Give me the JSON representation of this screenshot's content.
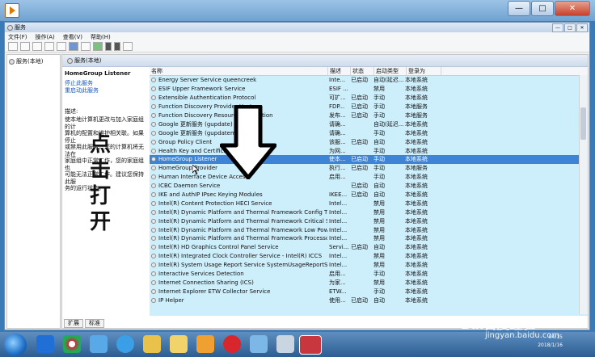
{
  "window": {
    "title": "服务",
    "close_glyph": "✕",
    "max_glyph": "□",
    "min_glyph": "—"
  },
  "menu": [
    "文件(F)",
    "操作(A)",
    "查看(V)",
    "帮助(H)"
  ],
  "tree": {
    "item": "服务(本地)"
  },
  "main_header": "服务(本地)",
  "description_panel": {
    "service_name": "HomeGroup Listener",
    "stop_link": "停止此服务",
    "restart_link": "重启动此服务",
    "desc_label": "描述:",
    "desc_text": "使本地计算机更改与加入家庭组的计\n算机的配置和维护相关联。如果停止\n或禁用此服务，您的计算机将无法在\n家庭组中正常工作，您的家庭组也\n可能无法正常工作。建议您保持此服\n务的运行状态。"
  },
  "columns": [
    "名称",
    "描述",
    "状态",
    "启动类型",
    "登录为"
  ],
  "rows": [
    [
      "Energy Server Service queencreek",
      "Inte...",
      "已启动",
      "自动(延迟...",
      "本地系统"
    ],
    [
      "ESIF Upper Framework Service",
      "ESIF ...",
      "",
      "禁用",
      "本地系统"
    ],
    [
      "Extensible Authentication Protocol",
      "可扩...",
      "已启动",
      "手动",
      "本地系统"
    ],
    [
      "Function Discovery Provider Host",
      "FDP...",
      "已启动",
      "手动",
      "本地服务"
    ],
    [
      "Function Discovery Resource Publication",
      "发布...",
      "已启动",
      "手动",
      "本地服务"
    ],
    [
      "Google 更新服务 (gupdate)",
      "请确...",
      "",
      "自动(延迟...",
      "本地系统"
    ],
    [
      "Google 更新服务 (gupdatem)",
      "请确...",
      "",
      "手动",
      "本地系统"
    ],
    [
      "Group Policy Client",
      "该服...",
      "已启动",
      "自动",
      "本地系统"
    ],
    [
      "Health Key and Certificate Management",
      "为网...",
      "",
      "手动",
      "本地系统"
    ],
    [
      "HomeGroup Listener",
      "使本...",
      "已启动",
      "手动",
      "本地系统"
    ],
    [
      "HomeGroup Provider",
      "执行...",
      "已启动",
      "手动",
      "本地服务"
    ],
    [
      "Human Interface Device Access",
      "启用...",
      "",
      "手动",
      "本地系统"
    ],
    [
      "ICBC Daemon Service",
      "",
      "已启动",
      "自动",
      "本地系统"
    ],
    [
      "IKE and AuthIP IPsec Keying Modules",
      "IKEE...",
      "已启动",
      "自动",
      "本地系统"
    ],
    [
      "Intel(R) Content Protection HECI Service",
      "Intel...",
      "",
      "禁用",
      "本地系统"
    ],
    [
      "Intel(R) Dynamic Platform and Thermal Framework Config TDP Se...",
      "Intel...",
      "",
      "禁用",
      "本地系统"
    ],
    [
      "Intel(R) Dynamic Platform and Thermal Framework Critical Service",
      "Intel...",
      "",
      "禁用",
      "本地系统"
    ],
    [
      "Intel(R) Dynamic Platform and Thermal Framework Low Power M...",
      "Intel...",
      "",
      "禁用",
      "本地系统"
    ],
    [
      "Intel(R) Dynamic Platform and Thermal Framework Processor Part...",
      "Intel...",
      "",
      "禁用",
      "本地系统"
    ],
    [
      "Intel(R) HD Graphics Control Panel Service",
      "Servi...",
      "已启动",
      "自动",
      "本地系统"
    ],
    [
      "Intel(R) Integrated Clock Controller Service - Intel(R) ICCS",
      "Intel...",
      "",
      "禁用",
      "本地系统"
    ],
    [
      "Intel(R) System Usage Report Service SystemUsageReportSvc QU...",
      "Intel...",
      "",
      "禁用",
      "本地系统"
    ],
    [
      "Interactive Services Detection",
      "启用...",
      "",
      "手动",
      "本地系统"
    ],
    [
      "Internet Connection Sharing (ICS)",
      "为家...",
      "",
      "禁用",
      "本地系统"
    ],
    [
      "Internet Explorer ETW Collector Service",
      "ETW...",
      "",
      "手动",
      "本地系统"
    ],
    [
      "IP Helper",
      "使用...",
      "已启动",
      "自动",
      "本地系统"
    ]
  ],
  "selected_row": 9,
  "tabs": [
    "扩展",
    "标准"
  ],
  "annotation": "点击打开",
  "taskbar": {
    "time": "04:15",
    "date": "2018/1/16"
  },
  "watermark": {
    "brand": "Bai百度经验",
    "url": "jingyan.baidu.com"
  }
}
